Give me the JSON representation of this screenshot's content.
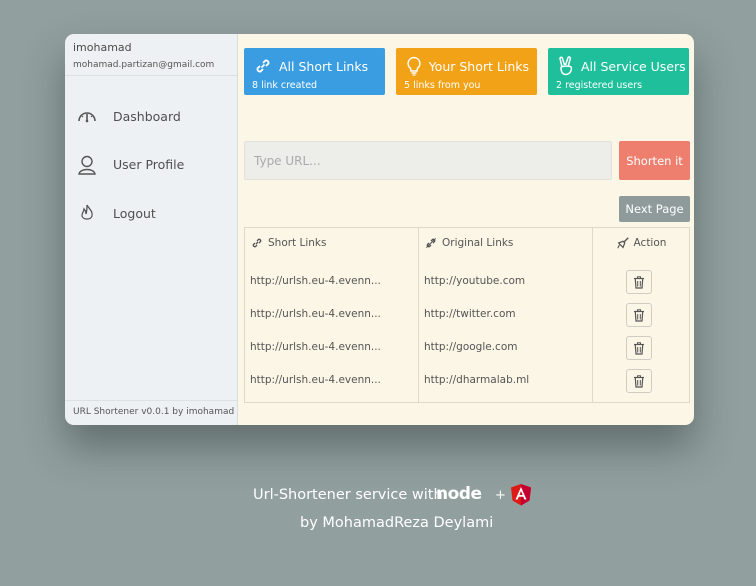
{
  "sidebar": {
    "username": "imohamad",
    "email": "mohamad.partizan@gmail.com",
    "items": [
      {
        "label": "Dashboard",
        "icon": "gauge-icon"
      },
      {
        "label": "User Profile",
        "icon": "user-icon"
      },
      {
        "label": "Logout",
        "icon": "flame-icon"
      }
    ],
    "footer": "URL Shortener v0.0.1 by imohamad"
  },
  "cards": [
    {
      "title": "All Short Links",
      "subtitle": "8 link created",
      "color": "#3a9de1",
      "icon": "link-icon"
    },
    {
      "title": "Your Short Links",
      "subtitle": "5 links from you",
      "color": "#f2a217",
      "icon": "lightbulb-icon"
    },
    {
      "title": "All Service Users",
      "subtitle": "2 registered users",
      "color": "#1fbf9c",
      "icon": "peace-hand-icon"
    }
  ],
  "form": {
    "url_placeholder": "Type URL...",
    "url_value": "",
    "shorten_label": "Shorten it"
  },
  "pagination": {
    "next_label": "Next Page"
  },
  "table": {
    "headers": {
      "short": "Short Links",
      "original": "Original Links",
      "action": "Action"
    },
    "rows": [
      {
        "short": "http://urlsh.eu-4.evenn...",
        "original": "http://youtube.com"
      },
      {
        "short": "http://urlsh.eu-4.evenn...",
        "original": "http://twitter.com"
      },
      {
        "short": "http://urlsh.eu-4.evenn...",
        "original": "http://google.com"
      },
      {
        "short": "http://urlsh.eu-4.evenn...",
        "original": "http://dharmalab.ml"
      }
    ]
  },
  "caption": {
    "line1": "Url-Shortener service with",
    "node_logo": "node",
    "plus": "+",
    "line2": "by MohamadReza Deylami"
  },
  "colors": {
    "background": "#929f9f",
    "main_bg": "#fbf6e6",
    "sidebar_bg": "#eef1f3",
    "shorten_button": "#ee7f6e",
    "next_button": "#8e9b9a",
    "angular_red": "#dd1b16"
  }
}
